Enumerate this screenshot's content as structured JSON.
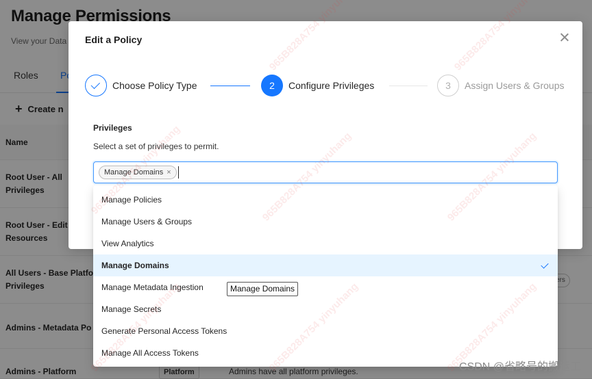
{
  "page": {
    "title": "Manage Permissions",
    "subtitle": "View your Data",
    "tabs": [
      "Roles",
      "Po"
    ],
    "create_label": "Create n",
    "table_header": "Name",
    "rows": [
      {
        "name_line1": "Root User - All",
        "name_line2": "Privileges"
      },
      {
        "name_line1": "Root User - Edit",
        "name_line2": "Resources"
      },
      {
        "name_line1": "All Users - Base Platfo",
        "name_line2": "Privileges"
      },
      {
        "name_line1": "Admins - Metadata Po",
        "name_line2": ""
      },
      {
        "name_line1": "Admins - Platform Policy",
        "name_line2": ""
      }
    ],
    "users_chip": "ers",
    "platform_tag": "Platform",
    "platform_desc": "Admins have all platform privileges."
  },
  "modal": {
    "title": "Edit a Policy",
    "steps": [
      {
        "number": "",
        "label": "Choose Policy Type",
        "status": "done"
      },
      {
        "number": "2",
        "label": "Configure Privileges",
        "status": "active"
      },
      {
        "number": "3",
        "label": "Assign Users & Groups",
        "status": "pending"
      }
    ],
    "field": {
      "label": "Privileges",
      "help": "Select a set of privileges to permit.",
      "selected_tag": "Manage Domains",
      "tag_close": "×"
    },
    "options": [
      {
        "label": "Manage Policies",
        "selected": false
      },
      {
        "label": "Manage Users & Groups",
        "selected": false
      },
      {
        "label": "View Analytics",
        "selected": false
      },
      {
        "label": "Manage Domains",
        "selected": true
      },
      {
        "label": "Manage Metadata Ingestion",
        "selected": false
      },
      {
        "label": "Manage Secrets",
        "selected": false
      },
      {
        "label": "Generate Personal Access Tokens",
        "selected": false
      },
      {
        "label": "Manage All Access Tokens",
        "selected": false
      }
    ],
    "tooltip": "Manage Domains"
  },
  "watermark": "965B828A754 yinyuhang",
  "credit": "CSDN @省略号的搬运工",
  "colors": {
    "accent": "#1677ff",
    "selected_bg": "#e6f4ff"
  }
}
